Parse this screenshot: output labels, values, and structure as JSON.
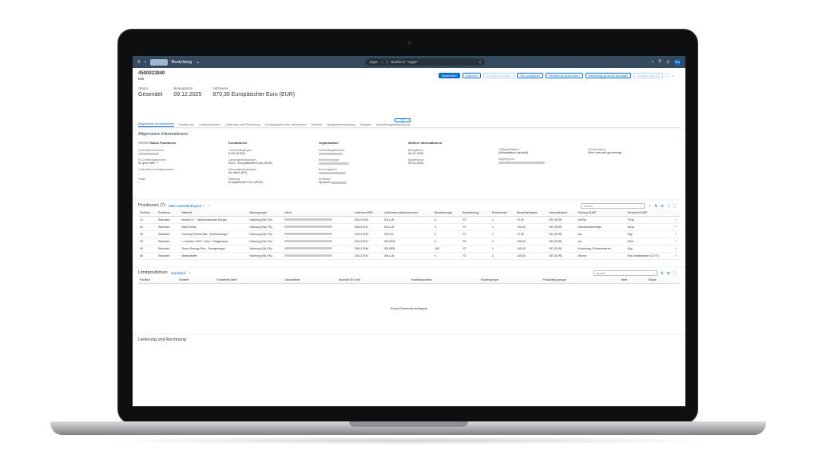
{
  "shell": {
    "back": "‹",
    "title": "Bestellung",
    "search_scope": "Apps",
    "search_placeholder": "Suche in: \"Apps\"",
    "avatar": "EN"
  },
  "header": {
    "object_id": "4500023840",
    "object_sub": "EIB",
    "kpis": [
      {
        "label": "Status",
        "value": "Gesendet"
      },
      {
        "label": "Belegdatum",
        "value": "09.12.2025"
      },
      {
        "label": "Nettowert",
        "value": "870,30 Europäischer Euro (EUR)"
      }
    ],
    "actions": [
      {
        "label": "Bearbeiten",
        "kind": "primary"
      },
      {
        "label": "Kopieren",
        "kind": "normal"
      },
      {
        "label": "Ausgabe anzeigen",
        "kind": "disabled"
      },
      {
        "label": "Neu ausgeben",
        "kind": "normal"
      },
      {
        "label": "Bestellung ausdrucken",
        "kind": "normal"
      },
      {
        "label": "Bestellung gedruckt anzeigen",
        "kind": "normal"
      },
      {
        "label": "Ausgabe sperren",
        "kind": "disabled"
      }
    ],
    "tabs": [
      "Allgemeine Informationen",
      "Positionen",
      "Limitpositionen",
      "Lieferung und Rechnung",
      "Kontaktdaten des Lieferanten",
      "Notizen",
      "Ausgabeverwaltung",
      "Anlagen",
      "Bestellungsentwicklung"
    ],
    "header_toggle": "‹ H ›"
  },
  "general": {
    "section_title": "Allgemeine Informationen",
    "columns": [
      {
        "heading": "Basis Positionen",
        "fields": [
          {
            "label": "Lieferanten-Nummer",
            "value": ""
          },
          {
            "label": "EU-Lieferungsnummer",
            "value": "Im grün Wel. **"
          },
          {
            "label": "Lieferanten-Auftragsnummer",
            "value": "–"
          },
          {
            "label": "Filiale",
            "value": "–"
          }
        ]
      },
      {
        "heading": "Konditionen",
        "fields": [
          {
            "label": "Lieferbedingungen",
            "value": "EXW (EXW)"
          },
          {
            "label": "Zahlungsbedingungen",
            "value": "0010 - Europäischer Euro (EUR)"
          },
          {
            "label": "Zahlungsbedingungen",
            "value": "Ab Werk (EX)"
          },
          {
            "label": "Währung",
            "value": "Europäischer Euro (EUR)"
          }
        ]
      },
      {
        "heading": "Organisation",
        "fields": [
          {
            "label": "Einkaufsorganisation",
            "value": ""
          },
          {
            "label": "Einkäufergruppe",
            "value": ""
          },
          {
            "label": "Buchungskreis",
            "value": ""
          },
          {
            "label": "Einkäufer",
            "value": "Sponsor"
          }
        ]
      },
      {
        "heading": "Weitere Informationen",
        "fields": [
          {
            "label": "Belegdatum",
            "value": "09.12.2025"
          },
          {
            "label": "Angelegt am",
            "value": "09.12.2025"
          },
          {
            "label": "Gedruckt am",
            "value": "–"
          }
        ]
      },
      {
        "heading": "",
        "fields": [
          {
            "label": "Gültigkeitsdatum",
            "value": "(Ablaufdatum gesetzt)"
          },
          {
            "label": "Angelegt von",
            "value": ""
          }
        ]
      },
      {
        "heading": "",
        "fields": [
          {
            "label": "Genehmigung",
            "value": "Nicht relevant genehmigt"
          }
        ]
      }
    ]
  },
  "positions": {
    "title": "Positionen (7)",
    "variant": "Mein Standardlayout *",
    "search_placeholder": "Suchen",
    "columns": [
      "Position",
      "Positions...",
      "Material",
      "Warengruppe",
      "Werk",
      "Lieferant MPN",
      "Lieferanten-Artikelnummer",
      "Bestellmenge",
      "Bestellmeng...",
      "Preiseinheit",
      "Bestellnettowert",
      "Herkunftsland",
      "Stufung ELWP",
      "Verkaufs ELWP"
    ],
    "rows": [
      {
        "pos": "10",
        "typ": "Standard",
        "mat": "Bubba LS - Tafelschokolade Burger",
        "wg": "Nahrung (NA-FN)",
        "werk": "",
        "mpn": "251117991",
        "lan": "GB-LLB",
        "menge": "0",
        "einh": "ST",
        "pe": "1",
        "wert": "70,00",
        "land": "DE (EUR)",
        "stuf": "NoFire",
        "vk": "700g"
      },
      {
        "pos": "20",
        "typ": "Standard",
        "mat": "Multi Kekse",
        "wg": "Nahrung (NA-FN)",
        "werk": "",
        "mpn": "251117931",
        "lan": "GB-LLB",
        "menge": "0",
        "einh": "ST",
        "pe": "1",
        "wert": "100,00",
        "land": "DE (EUR)",
        "stuf": "Schokoladenriegel",
        "vk": "440g"
      },
      {
        "pos": "30",
        "typ": "Standard",
        "mat": "Crowing Peanut Bar - Erdnussriegel",
        "wg": "Nahrung (NA-FN)",
        "werk": "",
        "mpn": "251117940",
        "lan": "GB-LFL",
        "menge": "0",
        "einh": "ST",
        "pe": "1",
        "wert": "72,00",
        "land": "DE (EUR)",
        "stuf": "n/a",
        "vk": "50g"
      },
      {
        "pos": "40",
        "typ": "Standard",
        "mat": "L-Carnitin 1000 + Zink + Magnesium",
        "wg": "Nahrung (NA-FN)",
        "werk": "",
        "mpn": "251117947",
        "lan": "GB-WOL",
        "menge": "0",
        "einh": "ST",
        "pe": "1",
        "wert": "108,00",
        "land": "DE (EUR)",
        "stuf": "n/a",
        "vk": "20ml"
      },
      {
        "pos": "50",
        "typ": "Standard",
        "mat": "Demo Energy Plus - Energieriegel",
        "wg": "Nahrung (NA-FN)",
        "werk": "",
        "mpn": "251117948",
        "lan": "GB-NEB",
        "menge": "100",
        "einh": "ST",
        "pe": "1",
        "wert": "145,00",
        "land": "DE (EUR)",
        "stuf": "Ernährung / Proteinbarren",
        "vk": "40g"
      },
      {
        "pos": "60",
        "typ": "Standard",
        "mat": "Bratkartoffel",
        "wg": "Nahrung (NA-FN)",
        "werk": "",
        "mpn": "251117943",
        "lan": "GB-LLB",
        "menge": "0",
        "einh": "ST",
        "pe": "1",
        "wert": "105,00",
        "land": "DE (EUR)",
        "stuf": "Zitrone",
        "vk": "Box-Inhaltsstoffe (32 ST)"
      }
    ]
  },
  "limits": {
    "title": "Limitpositionen",
    "variant": "Standard",
    "search_placeholder": "Suchen",
    "columns": [
      "Position",
      "Kontext",
      "Erwarteter Wert",
      "Gesamtlimit",
      "Kontrakt für Limit",
      "Kontraktposition",
      "Kontiergruppe",
      "Produkttyp-gruppe",
      "Wert",
      "Status"
    ],
    "empty_text": "Keine Elemente verfügbar"
  },
  "footer": {
    "section_title": "Lieferung und Rechnung"
  }
}
